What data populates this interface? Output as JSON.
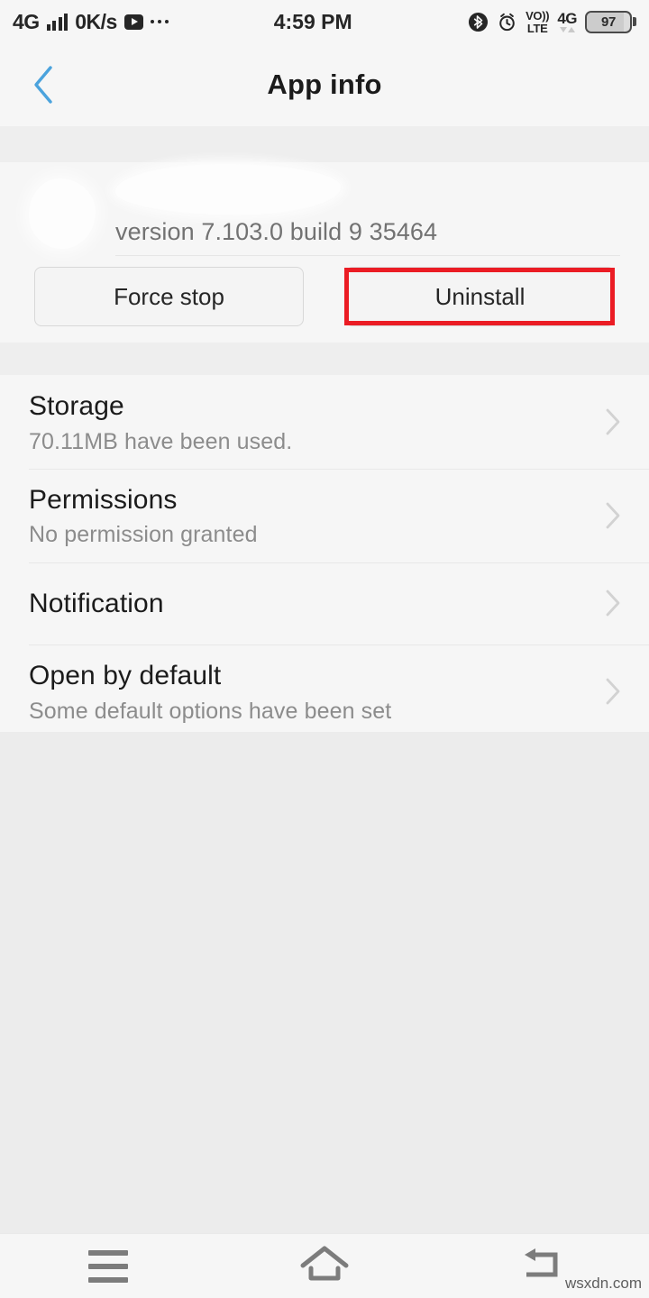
{
  "status_bar": {
    "network_type": "4G",
    "data_rate": "0K/s",
    "media_icon": "youtube-play-icon",
    "overflow_icon": "more-dots-icon",
    "time": "4:59 PM",
    "bluetooth_icon": "bluetooth-icon",
    "alarm_icon": "alarm-clock-icon",
    "volte_line1": "VO))",
    "volte_line2": "LTE",
    "network_type_right": "4G",
    "battery_percent": "97"
  },
  "app_bar": {
    "back_icon": "back-chevron-icon",
    "back_icon_color": "#4ba3dd",
    "title": "App info"
  },
  "app_header": {
    "icon": "app-icon-redacted",
    "name": "",
    "version": "version 7.103.0 build 9 35464"
  },
  "actions": {
    "force_stop_label": "Force stop",
    "uninstall_label": "Uninstall",
    "highlight_color": "#eb1c24",
    "highlight_target": "uninstall-button"
  },
  "list": {
    "rows": [
      {
        "title": "Storage",
        "subtitle": "70.11MB have been used.",
        "chevron": "chevron-right-icon"
      },
      {
        "title": "Permissions",
        "subtitle": "No permission granted",
        "chevron": "chevron-right-icon"
      },
      {
        "title": "Notification",
        "subtitle": "",
        "chevron": "chevron-right-icon"
      },
      {
        "title": "Open by default",
        "subtitle": "Some default options have been set",
        "chevron": "chevron-right-icon"
      }
    ]
  },
  "nav_bar": {
    "menu_icon": "menu-icon",
    "home_icon": "home-icon",
    "back_icon": "back-arrow-icon"
  },
  "watermark": "wsxdn.com"
}
